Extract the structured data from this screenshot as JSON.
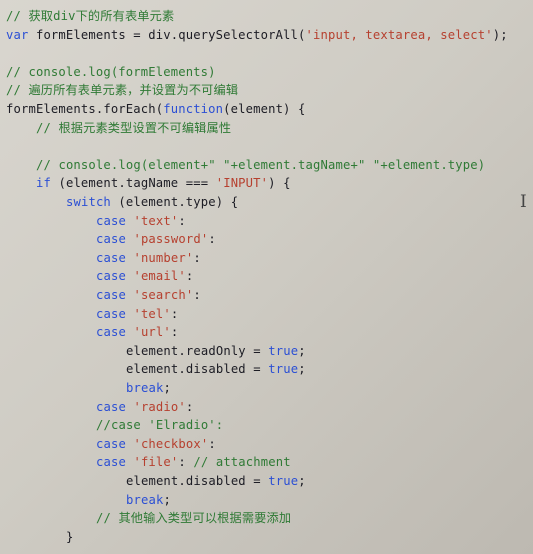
{
  "colors": {
    "comment": "#2f7a35",
    "keyword": "#2b4fd4",
    "string": "#b6402f",
    "identifier": "#1c1c24",
    "background": "#d4d1ca"
  },
  "cursor": {
    "glyph": "I",
    "icon": "text-cursor-icon"
  },
  "lines": [
    {
      "indent": 0,
      "tokens": [
        {
          "t": "// 获取div下的所有表单元素",
          "k": "comment"
        }
      ]
    },
    {
      "indent": 0,
      "tokens": [
        {
          "t": "var",
          "k": "keyword"
        },
        {
          "t": " formElements = div.querySelectorAll(",
          "k": "ident"
        },
        {
          "t": "'input, textarea, select'",
          "k": "string"
        },
        {
          "t": ");",
          "k": "ident"
        }
      ]
    },
    {
      "indent": 0,
      "tokens": []
    },
    {
      "indent": 0,
      "tokens": [
        {
          "t": "// console.log(formElements)",
          "k": "comment"
        }
      ]
    },
    {
      "indent": 0,
      "tokens": [
        {
          "t": "// 遍历所有表单元素，并设置为不可编辑",
          "k": "comment"
        }
      ]
    },
    {
      "indent": 0,
      "tokens": [
        {
          "t": "formElements.forEach(",
          "k": "ident"
        },
        {
          "t": "function",
          "k": "keyword"
        },
        {
          "t": "(element) {",
          "k": "ident"
        }
      ]
    },
    {
      "indent": 1,
      "tokens": [
        {
          "t": "// 根据元素类型设置不可编辑属性",
          "k": "comment"
        }
      ]
    },
    {
      "indent": 0,
      "tokens": []
    },
    {
      "indent": 1,
      "tokens": [
        {
          "t": "// console.log(element+\" \"+element.tagName+\" \"+element.type)",
          "k": "comment"
        }
      ]
    },
    {
      "indent": 1,
      "tokens": [
        {
          "t": "if",
          "k": "keyword"
        },
        {
          "t": " (element.tagName === ",
          "k": "ident"
        },
        {
          "t": "'INPUT'",
          "k": "string"
        },
        {
          "t": ") {",
          "k": "ident"
        }
      ]
    },
    {
      "indent": 2,
      "tokens": [
        {
          "t": "switch",
          "k": "keyword"
        },
        {
          "t": " (element.type) {",
          "k": "ident"
        }
      ]
    },
    {
      "indent": 3,
      "tokens": [
        {
          "t": "case",
          "k": "keyword"
        },
        {
          "t": " ",
          "k": "ident"
        },
        {
          "t": "'text'",
          "k": "string"
        },
        {
          "t": ":",
          "k": "ident"
        }
      ]
    },
    {
      "indent": 3,
      "tokens": [
        {
          "t": "case",
          "k": "keyword"
        },
        {
          "t": " ",
          "k": "ident"
        },
        {
          "t": "'password'",
          "k": "string"
        },
        {
          "t": ":",
          "k": "ident"
        }
      ]
    },
    {
      "indent": 3,
      "tokens": [
        {
          "t": "case",
          "k": "keyword"
        },
        {
          "t": " ",
          "k": "ident"
        },
        {
          "t": "'number'",
          "k": "string"
        },
        {
          "t": ":",
          "k": "ident"
        }
      ]
    },
    {
      "indent": 3,
      "tokens": [
        {
          "t": "case",
          "k": "keyword"
        },
        {
          "t": " ",
          "k": "ident"
        },
        {
          "t": "'email'",
          "k": "string"
        },
        {
          "t": ":",
          "k": "ident"
        }
      ]
    },
    {
      "indent": 3,
      "tokens": [
        {
          "t": "case",
          "k": "keyword"
        },
        {
          "t": " ",
          "k": "ident"
        },
        {
          "t": "'search'",
          "k": "string"
        },
        {
          "t": ":",
          "k": "ident"
        }
      ]
    },
    {
      "indent": 3,
      "tokens": [
        {
          "t": "case",
          "k": "keyword"
        },
        {
          "t": " ",
          "k": "ident"
        },
        {
          "t": "'tel'",
          "k": "string"
        },
        {
          "t": ":",
          "k": "ident"
        }
      ]
    },
    {
      "indent": 3,
      "tokens": [
        {
          "t": "case",
          "k": "keyword"
        },
        {
          "t": " ",
          "k": "ident"
        },
        {
          "t": "'url'",
          "k": "string"
        },
        {
          "t": ":",
          "k": "ident"
        }
      ]
    },
    {
      "indent": 4,
      "tokens": [
        {
          "t": "element.readOnly = ",
          "k": "ident"
        },
        {
          "t": "true",
          "k": "keyword"
        },
        {
          "t": ";",
          "k": "ident"
        }
      ]
    },
    {
      "indent": 4,
      "tokens": [
        {
          "t": "element.disabled = ",
          "k": "ident"
        },
        {
          "t": "true",
          "k": "keyword"
        },
        {
          "t": ";",
          "k": "ident"
        }
      ]
    },
    {
      "indent": 4,
      "tokens": [
        {
          "t": "break",
          "k": "keyword"
        },
        {
          "t": ";",
          "k": "ident"
        }
      ]
    },
    {
      "indent": 3,
      "tokens": [
        {
          "t": "case",
          "k": "keyword"
        },
        {
          "t": " ",
          "k": "ident"
        },
        {
          "t": "'radio'",
          "k": "string"
        },
        {
          "t": ":",
          "k": "ident"
        }
      ]
    },
    {
      "indent": 3,
      "tokens": [
        {
          "t": "//case 'Elradio':",
          "k": "comment"
        }
      ]
    },
    {
      "indent": 3,
      "tokens": [
        {
          "t": "case",
          "k": "keyword"
        },
        {
          "t": " ",
          "k": "ident"
        },
        {
          "t": "'checkbox'",
          "k": "string"
        },
        {
          "t": ":",
          "k": "ident"
        }
      ]
    },
    {
      "indent": 3,
      "tokens": [
        {
          "t": "case",
          "k": "keyword"
        },
        {
          "t": " ",
          "k": "ident"
        },
        {
          "t": "'file'",
          "k": "string"
        },
        {
          "t": ": ",
          "k": "ident"
        },
        {
          "t": "// attachment",
          "k": "comment"
        }
      ]
    },
    {
      "indent": 4,
      "tokens": [
        {
          "t": "element.disabled = ",
          "k": "ident"
        },
        {
          "t": "true",
          "k": "keyword"
        },
        {
          "t": ";",
          "k": "ident"
        }
      ]
    },
    {
      "indent": 4,
      "tokens": [
        {
          "t": "break",
          "k": "keyword"
        },
        {
          "t": ";",
          "k": "ident"
        }
      ]
    },
    {
      "indent": 3,
      "tokens": [
        {
          "t": "// 其他输入类型可以根据需要添加",
          "k": "comment"
        }
      ]
    },
    {
      "indent": 2,
      "tokens": [
        {
          "t": "}",
          "k": "ident"
        }
      ]
    }
  ]
}
